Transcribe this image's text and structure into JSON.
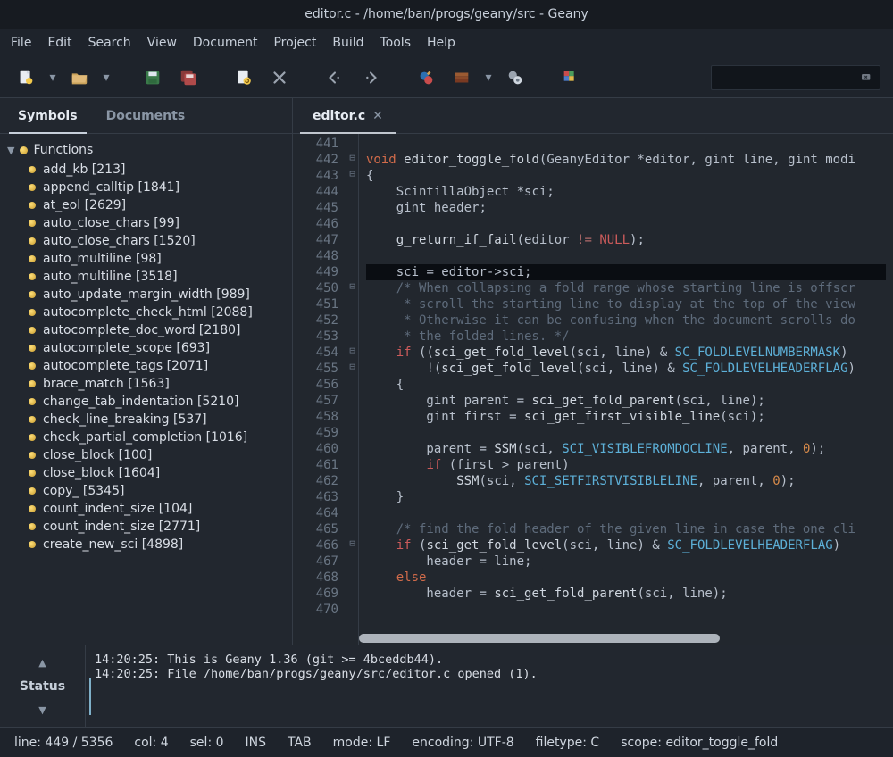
{
  "window": {
    "title": "editor.c - /home/ban/progs/geany/src - Geany"
  },
  "menu": [
    "File",
    "Edit",
    "Search",
    "View",
    "Document",
    "Project",
    "Build",
    "Tools",
    "Help"
  ],
  "sidebar": {
    "tabs": [
      "Symbols",
      "Documents"
    ],
    "active_tab": 0,
    "group_label": "Functions",
    "items": [
      "add_kb [213]",
      "append_calltip [1841]",
      "at_eol [2629]",
      "auto_close_chars [99]",
      "auto_close_chars [1520]",
      "auto_multiline [98]",
      "auto_multiline [3518]",
      "auto_update_margin_width [989]",
      "autocomplete_check_html [2088]",
      "autocomplete_doc_word [2180]",
      "autocomplete_scope [693]",
      "autocomplete_tags [2071]",
      "brace_match [1563]",
      "change_tab_indentation [5210]",
      "check_line_breaking [537]",
      "check_partial_completion [1016]",
      "close_block [100]",
      "close_block [1604]",
      "copy_ [5345]",
      "count_indent_size [104]",
      "count_indent_size [2771]",
      "create_new_sci [4898]"
    ]
  },
  "editor": {
    "tab_label": "editor.c",
    "first_line": 441,
    "highlight_line": 449,
    "lines": [
      {
        "n": 441,
        "html": ""
      },
      {
        "n": 442,
        "fold": "-",
        "html": "<span class='k-void'>void</span> <span class='fn'>editor_toggle_fold</span><span class='op'>(</span>GeanyEditor <span class='op'>*</span>editor<span class='op'>,</span> gint line<span class='op'>,</span> gint modi"
      },
      {
        "n": 443,
        "fold": "-",
        "html": "<span class='op'>{</span>"
      },
      {
        "n": 444,
        "html": "    ScintillaObject <span class='op'>*</span>sci<span class='op'>;</span>"
      },
      {
        "n": 445,
        "html": "    gint header<span class='op'>;</span>"
      },
      {
        "n": 446,
        "html": ""
      },
      {
        "n": 447,
        "html": "    <span class='fn'>g_return_if_fail</span><span class='op'>(</span>editor <span class='neg'>!=</span> <span class='null'>NULL</span><span class='op'>);</span>"
      },
      {
        "n": 448,
        "html": ""
      },
      {
        "n": 449,
        "hl": true,
        "html": "    sci <span class='op'>=</span> editor<span class='op'>-&gt;</span>sci<span class='op'>;</span>"
      },
      {
        "n": 450,
        "fold": "-",
        "html": "    <span class='cm'>/* When collapsing a fold range whose starting line is offscr</span>"
      },
      {
        "n": 451,
        "html": "    <span class='cm'> * scroll the starting line to display at the top of the view</span>"
      },
      {
        "n": 452,
        "html": "    <span class='cm'> * Otherwise it can be confusing when the document scrolls do</span>"
      },
      {
        "n": 453,
        "html": "    <span class='cm'> * the folded lines. */</span>"
      },
      {
        "n": 454,
        "fold": "-",
        "html": "    <span class='k-if'>if</span> <span class='op'>((</span><span class='fn'>sci_get_fold_level</span><span class='op'>(</span>sci<span class='op'>,</span> line<span class='op'>)</span> <span class='op'>&amp;</span> <span class='macro'>SC_FOLDLEVELNUMBERMASK</span><span class='op'>)</span>"
      },
      {
        "n": 455,
        "fold": "-",
        "html": "        <span class='op'>!(</span><span class='fn'>sci_get_fold_level</span><span class='op'>(</span>sci<span class='op'>,</span> line<span class='op'>)</span> <span class='op'>&amp;</span> <span class='macro'>SC_FOLDLEVELHEADERFLAG</span><span class='op'>)</span>"
      },
      {
        "n": 456,
        "html": "    <span class='op'>{</span>"
      },
      {
        "n": 457,
        "html": "        gint parent <span class='op'>=</span> <span class='fn'>sci_get_fold_parent</span><span class='op'>(</span>sci<span class='op'>,</span> line<span class='op'>);</span>"
      },
      {
        "n": 458,
        "html": "        gint first <span class='op'>=</span> <span class='fn'>sci_get_first_visible_line</span><span class='op'>(</span>sci<span class='op'>);</span>"
      },
      {
        "n": 459,
        "html": ""
      },
      {
        "n": 460,
        "html": "        parent <span class='op'>=</span> <span class='fn'>SSM</span><span class='op'>(</span>sci<span class='op'>,</span> <span class='macro'>SCI_VISIBLEFROMDOCLINE</span><span class='op'>,</span> parent<span class='op'>,</span> <span class='num'>0</span><span class='op'>);</span>"
      },
      {
        "n": 461,
        "html": "        <span class='k-if'>if</span> <span class='op'>(</span>first <span class='op'>&gt;</span> parent<span class='op'>)</span>"
      },
      {
        "n": 462,
        "html": "            <span class='fn'>SSM</span><span class='op'>(</span>sci<span class='op'>,</span> <span class='macro'>SCI_SETFIRSTVISIBLELINE</span><span class='op'>,</span> parent<span class='op'>,</span> <span class='num'>0</span><span class='op'>);</span>"
      },
      {
        "n": 463,
        "html": "    <span class='op'>}</span>"
      },
      {
        "n": 464,
        "html": ""
      },
      {
        "n": 465,
        "html": "    <span class='cm'>/* find the fold header of the given line in case the one cli</span>"
      },
      {
        "n": 466,
        "fold": "-",
        "html": "    <span class='k-if'>if</span> <span class='op'>(</span><span class='fn'>sci_get_fold_level</span><span class='op'>(</span>sci<span class='op'>,</span> line<span class='op'>)</span> <span class='op'>&amp;</span> <span class='macro'>SC_FOLDLEVELHEADERFLAG</span><span class='op'>)</span>"
      },
      {
        "n": 467,
        "html": "        header <span class='op'>=</span> line<span class='op'>;</span>"
      },
      {
        "n": 468,
        "html": "    <span class='k-else'>else</span>"
      },
      {
        "n": 469,
        "html": "        header <span class='op'>=</span> <span class='fn'>sci_get_fold_parent</span><span class='op'>(</span>sci<span class='op'>,</span> line<span class='op'>);</span>"
      },
      {
        "n": 470,
        "html": ""
      }
    ]
  },
  "messages": {
    "label": "Status",
    "lines": [
      "14:20:25: This is Geany 1.36 (git >= 4bceddb44).",
      "14:20:25: File /home/ban/progs/geany/src/editor.c opened (1)."
    ]
  },
  "status": {
    "line": "line: 449 / 5356",
    "col": "col: 4",
    "sel": "sel: 0",
    "ins": "INS",
    "tab": "TAB",
    "mode": "mode: LF",
    "encoding": "encoding: UTF-8",
    "filetype": "filetype: C",
    "scope": "scope: editor_toggle_fold"
  }
}
